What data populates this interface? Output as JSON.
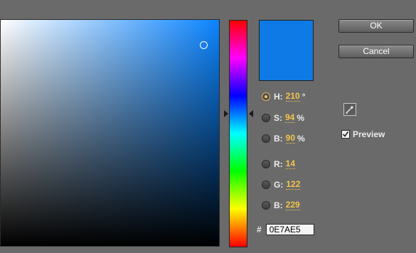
{
  "picker": {
    "current_color": "#0E7AE5",
    "field_base_color": "#0a84ff"
  },
  "buttons": {
    "ok_label": "OK",
    "cancel_label": "Cancel"
  },
  "hsb": {
    "h": {
      "label": "H:",
      "value": "210",
      "unit": "°",
      "selected": true
    },
    "s": {
      "label": "S:",
      "value": "94",
      "unit": "%"
    },
    "b": {
      "label": "B:",
      "value": "90",
      "unit": "%"
    }
  },
  "rgb": {
    "r": {
      "label": "R:",
      "value": "14"
    },
    "g": {
      "label": "G:",
      "value": "122"
    },
    "b": {
      "label": "B:",
      "value": "229"
    }
  },
  "hex": {
    "label": "#",
    "value": "0E7AE5"
  },
  "preview": {
    "label": "Preview",
    "checked": true
  },
  "icons": {
    "eyedropper": "eyedropper-icon",
    "check": "checkmark-icon"
  }
}
